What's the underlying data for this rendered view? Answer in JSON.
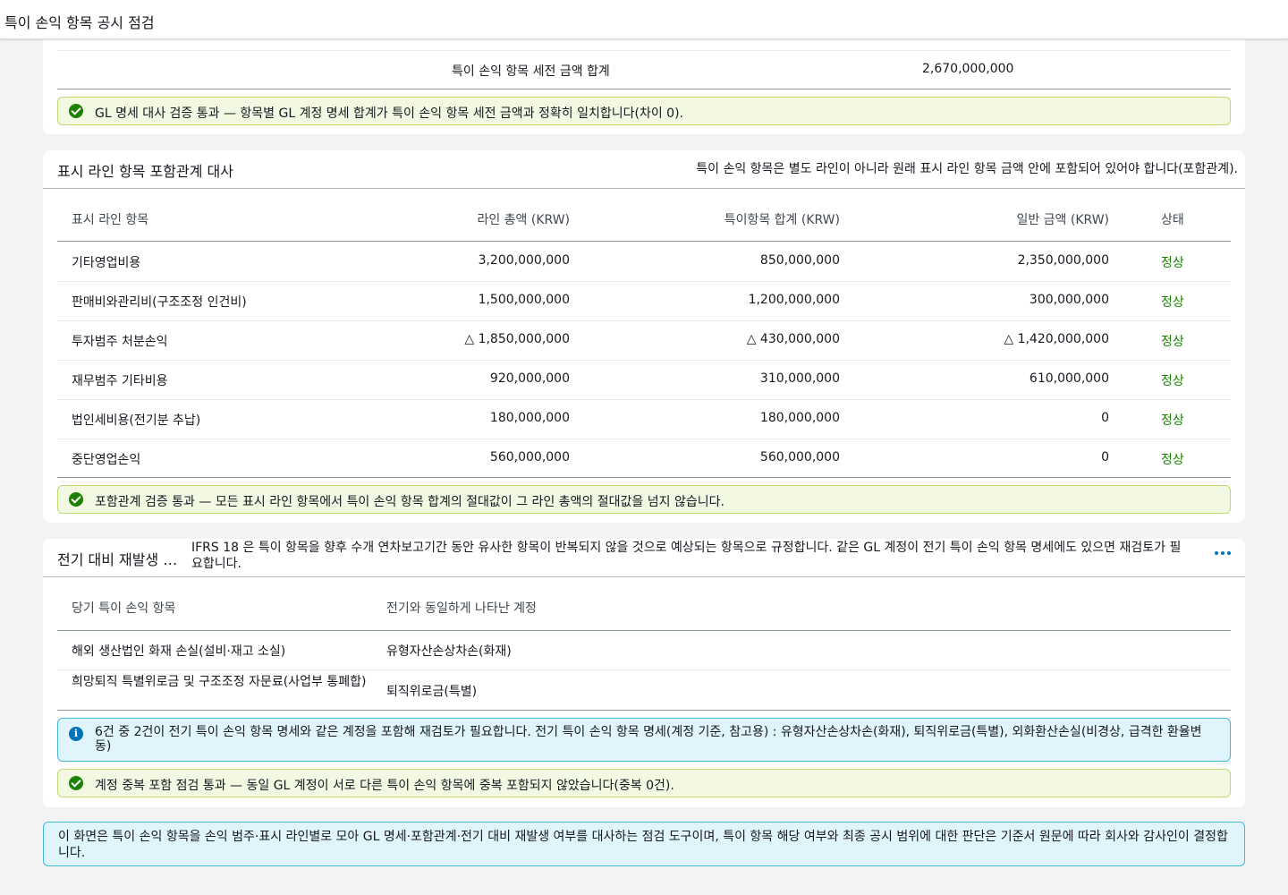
{
  "header": {
    "title": "특이 손익 항목 공시 점검"
  },
  "gl_section": {
    "total_label": "특이 손익 항목 세전 금액 합계",
    "total_value": "2,670,000,000",
    "success_text": "GL 명세 대사 검증 통과 — 항목별 GL 계정 명세 합계가 특이 손익 항목 세전 금액과 정확히 일치합니다(차이 0)."
  },
  "inclusion_section": {
    "title": "표시 라인 항목 포함관계 대사",
    "description": "특이 손익 항목은 별도 라인이 아니라 원래 표시 라인 항목 금액 안에 포함되어 있어야 합니다(포함관계).",
    "columns": [
      "표시 라인 항목",
      "라인 총액 (KRW)",
      "특이항목 합계 (KRW)",
      "일반 금액 (KRW)",
      "상태"
    ],
    "rows": [
      {
        "item": "기타영업비용",
        "line_total": "3,200,000,000",
        "special_total": "850,000,000",
        "general": "2,350,000,000",
        "status": "정상"
      },
      {
        "item": "판매비와관리비(구조조정 인건비)",
        "line_total": "1,500,000,000",
        "special_total": "1,200,000,000",
        "general": "300,000,000",
        "status": "정상"
      },
      {
        "item": "투자범주 처분손익",
        "line_total": "△ 1,850,000,000",
        "special_total": "△ 430,000,000",
        "general": "△ 1,420,000,000",
        "status": "정상"
      },
      {
        "item": "재무범주 기타비용",
        "line_total": "920,000,000",
        "special_total": "310,000,000",
        "general": "610,000,000",
        "status": "정상"
      },
      {
        "item": "법인세비용(전기분 추납)",
        "line_total": "180,000,000",
        "special_total": "180,000,000",
        "general": "0",
        "status": "정상"
      },
      {
        "item": "중단영업손익",
        "line_total": "560,000,000",
        "special_total": "560,000,000",
        "general": "0",
        "status": "정상"
      }
    ],
    "success_text": "포함관계 검증 통과 — 모든 표시 라인 항목에서 특이 손익 항목 합계의 절대값이 그 라인 총액의 절대값을 넘지 않습니다."
  },
  "recurrence_section": {
    "title": "전기 대비 재발생 …",
    "description": "IFRS 18 은 특이 항목을 향후 수개 연차보고기간 동안 유사한 항목이 반복되지 않을 것으로 예상되는 항목으로 규정합니다. 같은 GL 계정이 전기 특이 손익 항목 명세에도 있으면 재검토가 필요합니다.",
    "columns": [
      "당기 특이 손익 항목",
      "전기와 동일하게 나타난 계정"
    ],
    "rows": [
      {
        "item": "해외 생산법인 화재 손실(설비·재고 소실)",
        "account": "유형자산손상차손(화재)"
      },
      {
        "item": "희망퇴직 특별위로금 및 구조조정 자문료(사업부 통폐합)",
        "account": "퇴직위로금(특별)"
      }
    ],
    "info_text": "6건 중 2건이 전기 특이 손익 항목 명세와 같은 계정을 포함해 재검토가 필요합니다. 전기 특이 손익 항목 명세(계정 기준, 참고용) : 유형자산손상차손(화재), 퇴직위로금(특별), 외화환산손실(비경상, 급격한 환율변동)",
    "success_text": "계정 중복 포함 점검 통과 — 동일 GL 계정이 서로 다른 특이 손익 항목에 중복 포함되지 않았습니다(중복 0건)."
  },
  "footer": {
    "text": "이 화면은 특이 손익 항목을 손익 범주·표시 라인별로 모아 GL 명세·포함관계·전기 대비 재발생 여부를 대사하는 점검 도구이며, 특이 항목 해당 여부와 최종 공시 범위에 대한 판단은 기준서 원문에 따라 회사와 감사인이 결정합니다."
  }
}
